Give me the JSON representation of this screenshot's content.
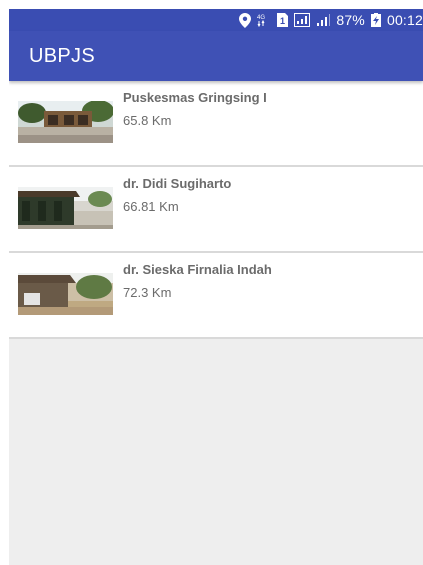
{
  "status_bar": {
    "icons": [
      "location-icon",
      "network-4g-icon",
      "sim-icon",
      "signal-icon",
      "signal-icon",
      "battery-charging-icon"
    ],
    "network_label": "4G",
    "sim_label": "1",
    "battery_percent": "87%",
    "time": "00:12"
  },
  "app_bar": {
    "title": "UBPJS"
  },
  "list": {
    "items": [
      {
        "name": "Puskesmas Gringsing I",
        "distance": "65.8 Km",
        "thumb_icon": "building-photo"
      },
      {
        "name": "dr. Didi Sugiharto",
        "distance": "66.81 Km",
        "thumb_icon": "street-photo"
      },
      {
        "name": "dr. Sieska Firnalia Indah",
        "distance": "72.3 Km",
        "thumb_icon": "house-photo"
      }
    ]
  }
}
